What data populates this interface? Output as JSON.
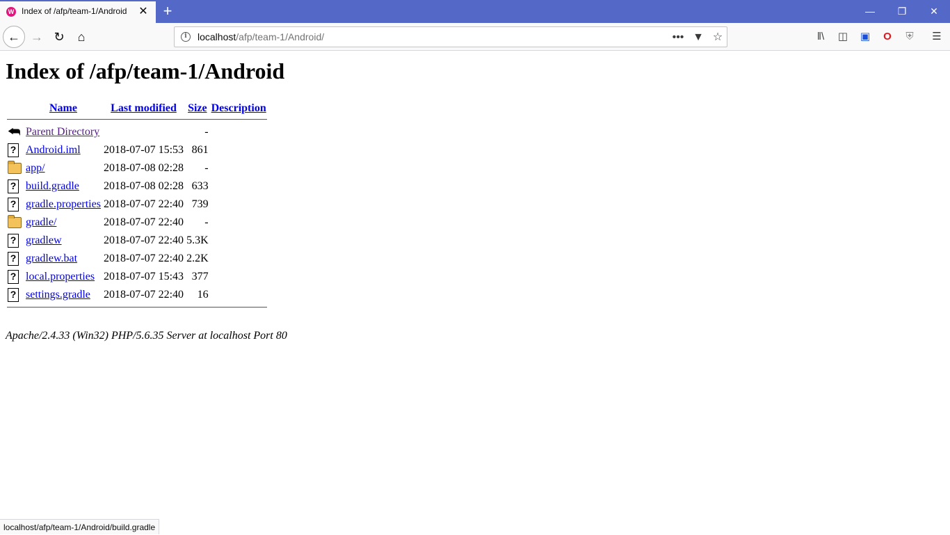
{
  "browser": {
    "tab_title": "Index of /afp/team-1/Android",
    "favicon_glyph": "W",
    "new_tab_glyph": "+",
    "url_host": "localhost",
    "url_path": "/afp/team-1/Android/",
    "accent_color": "#5468c8",
    "status_url": "localhost/afp/team-1/Android/build.gradle"
  },
  "page": {
    "heading": "Index of /afp/team-1/Android",
    "columns": {
      "name": "Name",
      "last_modified": "Last modified",
      "size": "Size",
      "description": "Description"
    },
    "parent": {
      "name": "Parent Directory",
      "size": "-",
      "icon": "back-arrow-icon"
    },
    "rows": [
      {
        "name": "Android.iml",
        "modified": "2018-07-07 15:53",
        "size": "861",
        "icon": "unknown-file-icon"
      },
      {
        "name": "app/",
        "modified": "2018-07-08 02:28",
        "size": "-",
        "icon": "folder-icon"
      },
      {
        "name": "build.gradle",
        "modified": "2018-07-08 02:28",
        "size": "633",
        "icon": "unknown-file-icon"
      },
      {
        "name": "gradle.properties",
        "modified": "2018-07-07 22:40",
        "size": "739",
        "icon": "unknown-file-icon"
      },
      {
        "name": "gradle/",
        "modified": "2018-07-07 22:40",
        "size": "-",
        "icon": "folder-icon"
      },
      {
        "name": "gradlew",
        "modified": "2018-07-07 22:40",
        "size": "5.3K",
        "icon": "unknown-file-icon"
      },
      {
        "name": "gradlew.bat",
        "modified": "2018-07-07 22:40",
        "size": "2.2K",
        "icon": "unknown-file-icon"
      },
      {
        "name": "local.properties",
        "modified": "2018-07-07 15:43",
        "size": "377",
        "icon": "unknown-file-icon"
      },
      {
        "name": "settings.gradle",
        "modified": "2018-07-07 22:40",
        "size": "16",
        "icon": "unknown-file-icon"
      }
    ],
    "footer": "Apache/2.4.33 (Win32) PHP/5.6.35 Server at localhost Port 80"
  }
}
